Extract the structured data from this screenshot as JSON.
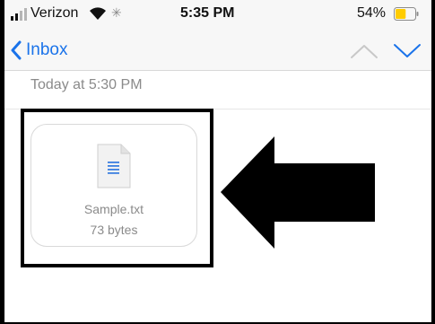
{
  "status_bar": {
    "carrier": "Verizon",
    "time": "5:35 PM",
    "battery_percent": "54%",
    "battery_level": 0.54,
    "battery_color": "#ffcc00"
  },
  "nav_bar": {
    "back_label": "Inbox",
    "back_icon": "chevron-left-icon",
    "prev_icon": "chevron-up-icon",
    "next_icon": "chevron-down-icon",
    "accent_color": "#1a73ea"
  },
  "message": {
    "date_text": "Today at 5:30 PM"
  },
  "attachment": {
    "icon": "text-file-icon",
    "file_name": "Sample.txt",
    "file_size": "73 bytes"
  },
  "annotation": {
    "highlight_box_color": "#000000",
    "arrow_direction": "left",
    "arrow_color": "#000000"
  }
}
